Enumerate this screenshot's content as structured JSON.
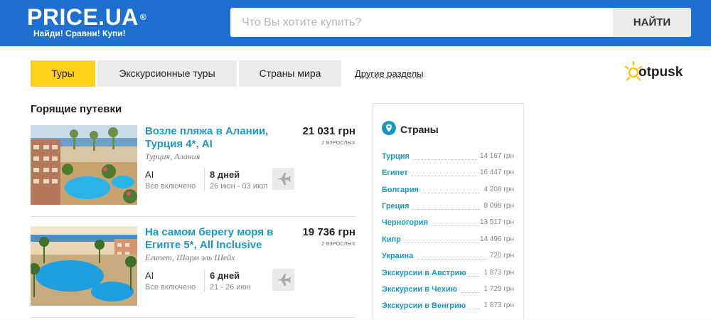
{
  "header": {
    "brand": "PRICE.UA",
    "registered": "®",
    "slogan": "Найди! Сравни! Купи!",
    "search_placeholder": "Что Вы хотите купить?",
    "search_button": "НАЙТИ",
    "colors": {
      "header_bg": "#1f6fd0",
      "accent": "#ffd11a",
      "link": "#1a99c0"
    }
  },
  "tabs": [
    {
      "label": "Туры",
      "active": true
    },
    {
      "label": "Экскурсионные туры",
      "active": false
    },
    {
      "label": "Страны мира",
      "active": false
    }
  ],
  "other_sections": "Другие разделы",
  "partner_logo": "otpusk",
  "hot_tours": {
    "title": "Горящие путевки",
    "items": [
      {
        "title": "Возле пляжа в Алании, Турция 4*, AI",
        "place": "Турция, Алания",
        "price": "21 031 грн",
        "pax": "2 ВЗРОСЛЫХ",
        "meal": "AI",
        "meal_desc": "Все включено",
        "days": "8 дней",
        "dates": "26 июн - 03 июл",
        "icon": "plane-icon"
      },
      {
        "title": "На самом берегу моря в Египте 5*, All Inclusive",
        "place": "Египет, Шарм эль Шейх",
        "price": "19 736 грн",
        "pax": "2 ВЗРОСЛЫХ",
        "meal": "AI",
        "meal_desc": "Все включено",
        "days": "6 дней",
        "dates": "21 - 26 июн",
        "icon": "plane-icon"
      }
    ]
  },
  "countries": {
    "title": "Страны",
    "items": [
      {
        "name": "Турция",
        "price": "14 167 грн"
      },
      {
        "name": "Египет",
        "price": "16 447 грн"
      },
      {
        "name": "Болгария",
        "price": "4 208 грн"
      },
      {
        "name": "Греция",
        "price": "8 098 грн"
      },
      {
        "name": "Черногория",
        "price": "13 517 грн"
      },
      {
        "name": "Кипр",
        "price": "14 496 грн"
      },
      {
        "name": "Украина",
        "price": "720 грн"
      },
      {
        "name": "Экскурсии в Австрию",
        "price": "1 873 грн"
      },
      {
        "name": "Экскурсии в Чехию",
        "price": "1 729 грн"
      },
      {
        "name": "Экскурсии в Венгрию",
        "price": "1 873 грн"
      }
    ]
  }
}
